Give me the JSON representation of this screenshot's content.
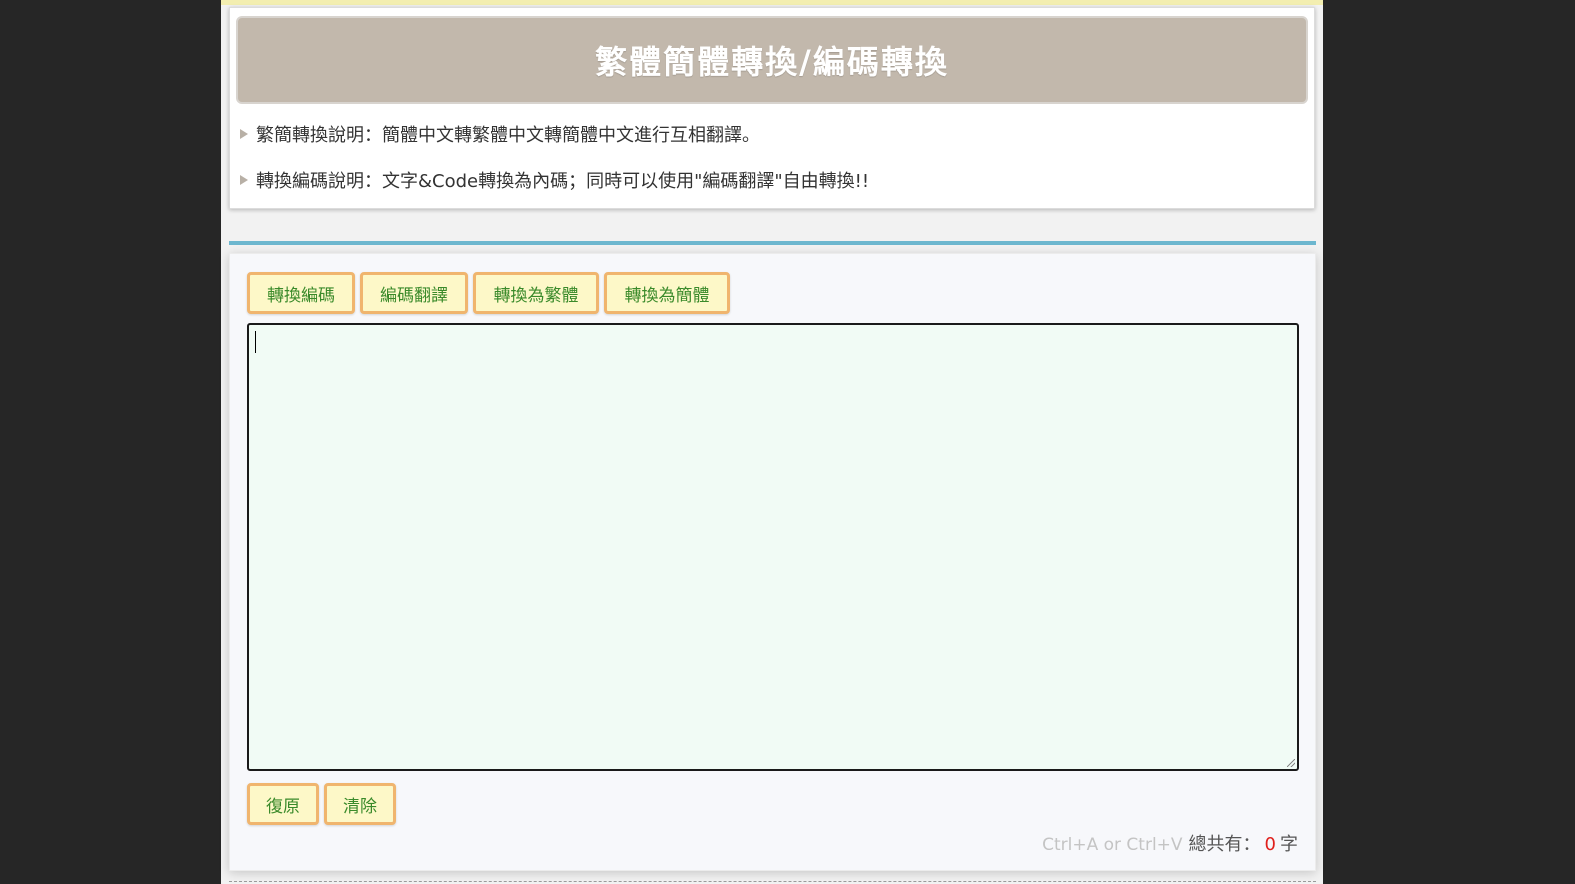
{
  "header": {
    "title": "繁體簡體轉換/編碼轉換"
  },
  "notes": [
    "繁簡轉換說明：簡體中文轉繁體中文轉簡體中文進行互相翻譯。",
    "轉換編碼說明：文字&Code轉換為內碼；同時可以使用\"編碼翻譯\"自由轉換!!"
  ],
  "toolbar": {
    "encode_label": "轉換編碼",
    "decode_label": "編碼翻譯",
    "to_traditional_label": "轉換為繁體",
    "to_simplified_label": "轉換為簡體"
  },
  "editor": {
    "value": ""
  },
  "actions": {
    "restore_label": "復原",
    "clear_label": "清除"
  },
  "counter": {
    "hint": "Ctrl+A or Ctrl+V",
    "prefix": "總共有：",
    "count": "0",
    "suffix": "字"
  },
  "colors": {
    "title_bg": "#c2b8ac",
    "button_bg": "#fdf8c8",
    "button_border": "#f0b56e",
    "button_text": "#3a8a2a",
    "divider": "#6db7cf",
    "editor_bg": "#f1fbf5",
    "count_color": "#e0201c"
  }
}
